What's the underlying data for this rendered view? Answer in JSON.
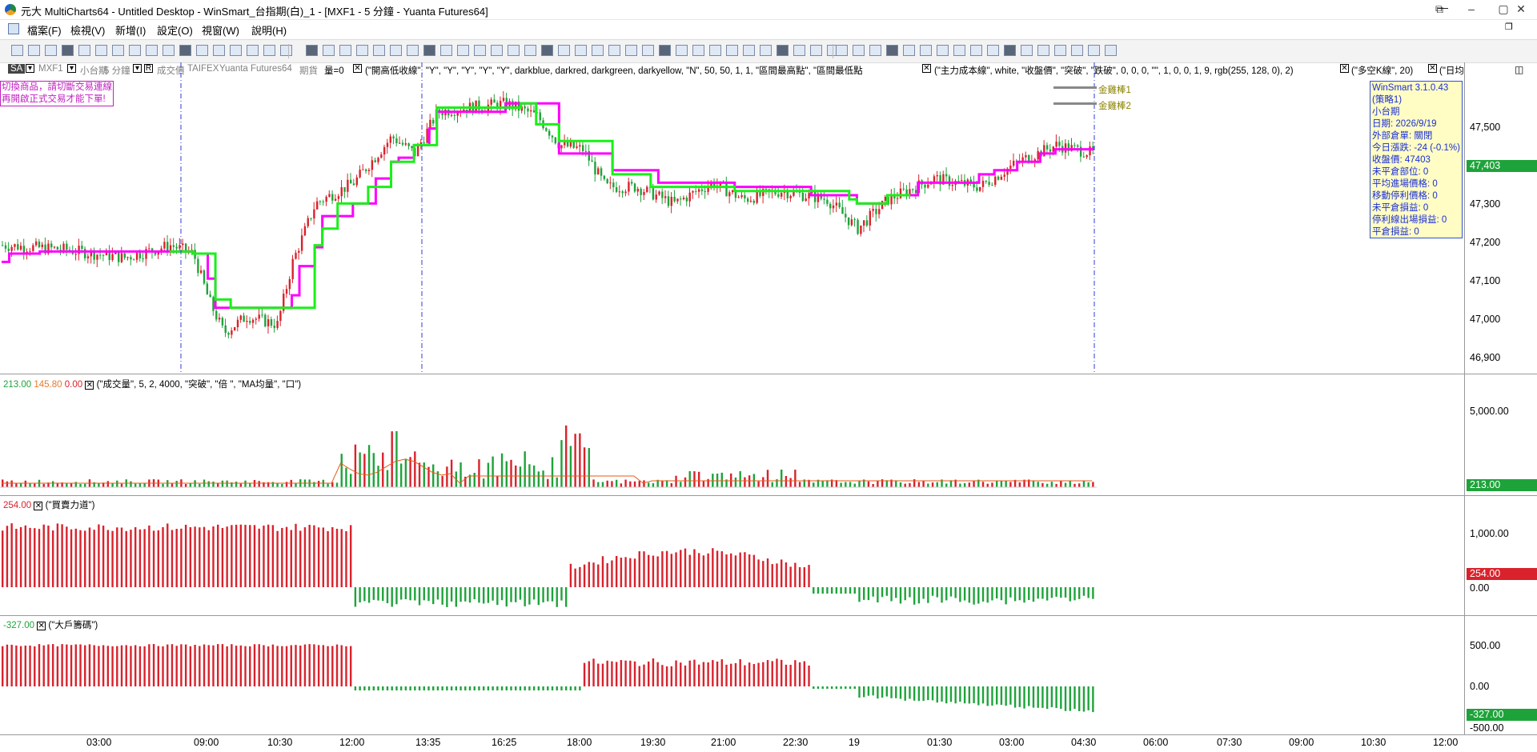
{
  "window": {
    "title": "元大 MultiCharts64 - Untitled Desktop - WinSmart_台指期(白)_1 - [MXF1 - 5 分鐘 - Yuanta Futures64]"
  },
  "menu": [
    "檔案(F)",
    "檢視(V)",
    "新增(I)",
    "設定(O)",
    "視窗(W)",
    "說明(H)"
  ],
  "infobar": {
    "badge": "SA",
    "symbol": "MXF1",
    "product": "小台期",
    "interval": "5 分鐘",
    "price_type": "成交價",
    "exchange": "TAIFEX",
    "datafeed": "Yuanta Futures64",
    "category": "期貨",
    "volume_label": "量=0",
    "study1": "(\"開高低收線\", \"Y\", \"Y\", \"Y\", \"Y\", \"Y\", darkblue, darkred, darkgreen, darkyellow, \"N\", 50, 50, 1, 1, \"區間最高點\", \"區間最低點",
    "study2": "(\"主力成本線\", white, \"收盤價\", \"突破\", \"跌破\", 0, 0, 0, \"\", 1, 0, 0, 1, 9, rgb(255, 128, 0), 2)",
    "study3": "(\"多空K線\", 20)",
    "study4": "(\"日均"
  },
  "warning": [
    "切換商品，請切斷交易連線",
    "再開啟正式交易才能下單!"
  ],
  "infobox": [
    "WinSmart 3.1.0.43",
    "(策略1)",
    "小台期",
    "日期: 2026/9/19",
    "外部倉單: 關閉",
    "今日漲跌: -24 (-0.1%)",
    "收盤價: 47403",
    "未平倉部位: 0",
    "平均進場價格: 0",
    "移動停利價格: 0",
    "未平倉損益: 0",
    "停利線出場損益: 0",
    "平倉損益: 0"
  ],
  "legend_lines": [
    "金雞棒1",
    "金雞棒2"
  ],
  "colors": {
    "up": "#d9222c",
    "down": "#1ea33a",
    "magenta_line": "#ff00ff",
    "green_line": "#19f019"
  },
  "price_pane": {
    "yaxis": [
      "47,500",
      "47,400",
      "47,300",
      "47,200",
      "47,100",
      "47,000",
      "46,900"
    ],
    "last": "47,403"
  },
  "volume_pane": {
    "header_values": [
      "213.00",
      "145.80",
      "0.00"
    ],
    "study": "(\"成交量\", 5, 2, 4000, \"突破\", \"倍 \", \"MA均量\", \"口\")",
    "yaxis": [
      "5,000.00"
    ],
    "last": "213.00"
  },
  "power_pane": {
    "header_value": "254.00",
    "study": "(\"買賣力道\")",
    "yaxis": [
      "1,000.00",
      "0.00"
    ],
    "last": "254.00"
  },
  "chip_pane": {
    "header_value": "-327.00",
    "study": "(\"大戶籌碼\")",
    "yaxis": [
      "500.00",
      "0.00",
      "-500.00"
    ],
    "last": "-327.00"
  },
  "xaxis": [
    "03:00",
    "09:00",
    "10:30",
    "12:00",
    "13:35",
    "16:25",
    "18:00",
    "19:30",
    "21:00",
    "22:30",
    "19",
    "01:30",
    "03:00",
    "04:30",
    "06:00",
    "07:30",
    "09:00",
    "10:30",
    "12:00"
  ],
  "chart_data": {
    "type": "candlestick",
    "symbol": "MXF1",
    "interval": "5 分鐘",
    "price_range": [
      46880,
      47580
    ],
    "last_close": 47403,
    "volume_last": 213,
    "volume_ma": 145.8,
    "power_last": 254,
    "chip_last": -327
  }
}
